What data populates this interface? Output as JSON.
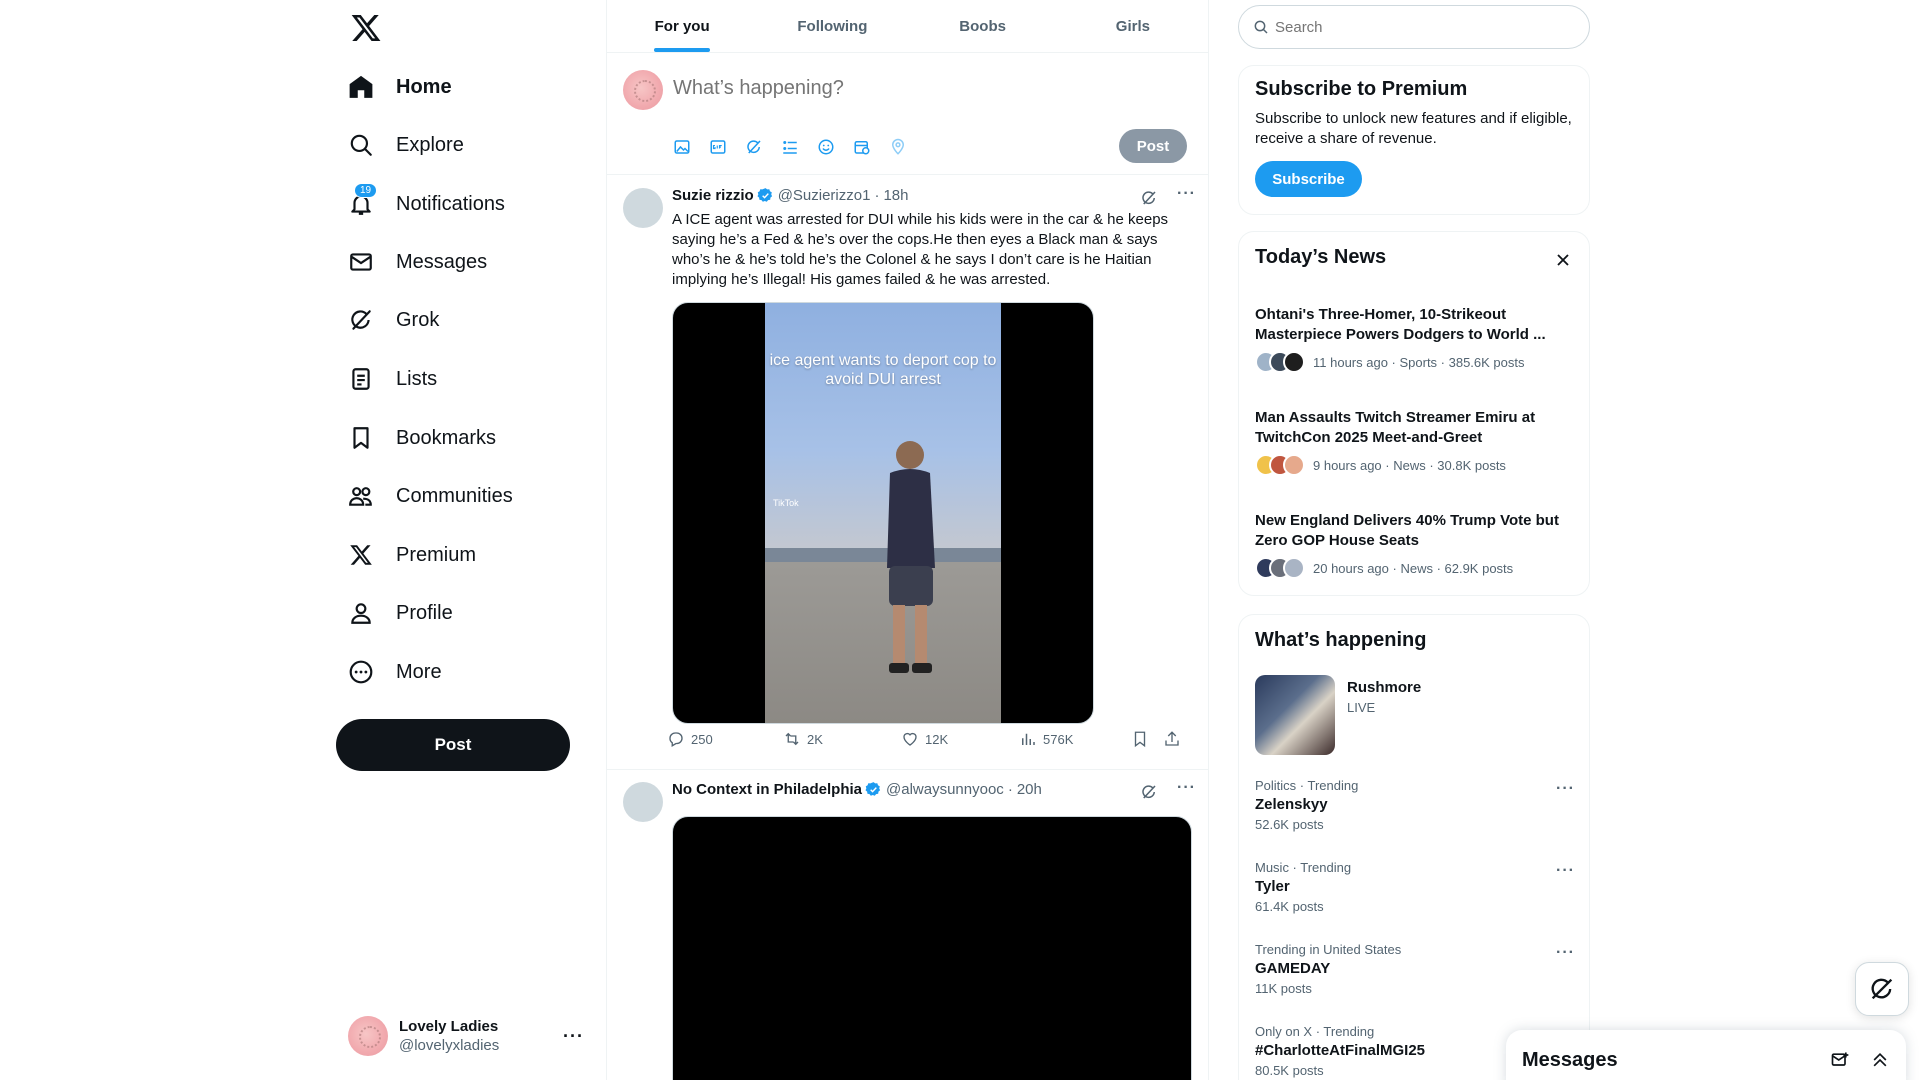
{
  "nav": {
    "items": [
      {
        "label": "Home",
        "icon": "home-icon"
      },
      {
        "label": "Explore",
        "icon": "search-icon"
      },
      {
        "label": "Notifications",
        "icon": "bell-icon",
        "badge": "19"
      },
      {
        "label": "Messages",
        "icon": "envelope-icon"
      },
      {
        "label": "Grok",
        "icon": "grok-icon"
      },
      {
        "label": "Lists",
        "icon": "lists-icon"
      },
      {
        "label": "Bookmarks",
        "icon": "bookmark-icon"
      },
      {
        "label": "Communities",
        "icon": "communities-icon"
      },
      {
        "label": "Premium",
        "icon": "x-logo-icon"
      },
      {
        "label": "Profile",
        "icon": "person-icon"
      },
      {
        "label": "More",
        "icon": "more-circle-icon"
      }
    ],
    "post_button": "Post"
  },
  "account": {
    "name": "Lovely Ladies",
    "handle": "@lovelyxladies"
  },
  "tabs": [
    "For you",
    "Following",
    "Boobs",
    "Girls"
  ],
  "composer": {
    "placeholder": "What’s happening?",
    "post_button": "Post"
  },
  "tweets": [
    {
      "name": "Suzie rizzio",
      "handle": "@Suzierizzo1",
      "time": "18h",
      "text": "A ICE agent was arrested for DUI while his kids were in the car & he keeps saying he’s a Fed & he’s over the cops.He then eyes a Black man & says who’s he & he’s told he’s the Colonel & he says I don’t care is he Haitian implying he’s Illegal! His games failed & he was arrested.",
      "video_caption": "ice agent wants to deport cop to avoid DUI arrest",
      "video_watermark": "TikTok",
      "replies": "250",
      "reposts": "2K",
      "likes": "12K",
      "views": "576K"
    },
    {
      "name": "No Context in Philadelphia",
      "handle": "@alwaysunnyooc",
      "time": "20h"
    }
  ],
  "search": {
    "placeholder": "Search"
  },
  "premium": {
    "title": "Subscribe to Premium",
    "text": "Subscribe to unlock new features and if eligible, receive a share of revenue.",
    "button": "Subscribe"
  },
  "news": {
    "title": "Today’s News",
    "items": [
      {
        "title": "Ohtani's Three-Homer, 10-Strikeout Masterpiece Powers Dodgers to World ...",
        "meta": "11 hours ago · Sports · 385.6K posts"
      },
      {
        "title": "Man Assaults Twitch Streamer Emiru at TwitchCon 2025 Meet-and-Greet",
        "meta": "9 hours ago · News · 30.8K posts"
      },
      {
        "title": "New England Delivers 40% Trump Vote but Zero GOP House Seats",
        "meta": "20 hours ago · News · 62.9K posts"
      }
    ]
  },
  "happening": {
    "title": "What’s happening",
    "live": {
      "title": "Rushmore",
      "status": "LIVE"
    },
    "trends": [
      {
        "context": "Politics · Trending",
        "name": "Zelenskyy",
        "count": "52.6K posts"
      },
      {
        "context": "Music · Trending",
        "name": "Tyler",
        "count": "61.4K posts"
      },
      {
        "context": "Trending in United States",
        "name": "GAMEDAY",
        "count": "11K posts"
      },
      {
        "context": "Only on X · Trending",
        "name": "#CharlotteAtFinalMGI25",
        "count": "80.5K posts"
      }
    ]
  },
  "messages_dock": {
    "title": "Messages"
  },
  "colors": {
    "accent": "#1d9bf0",
    "text": "#0f1419",
    "muted": "#536471"
  }
}
